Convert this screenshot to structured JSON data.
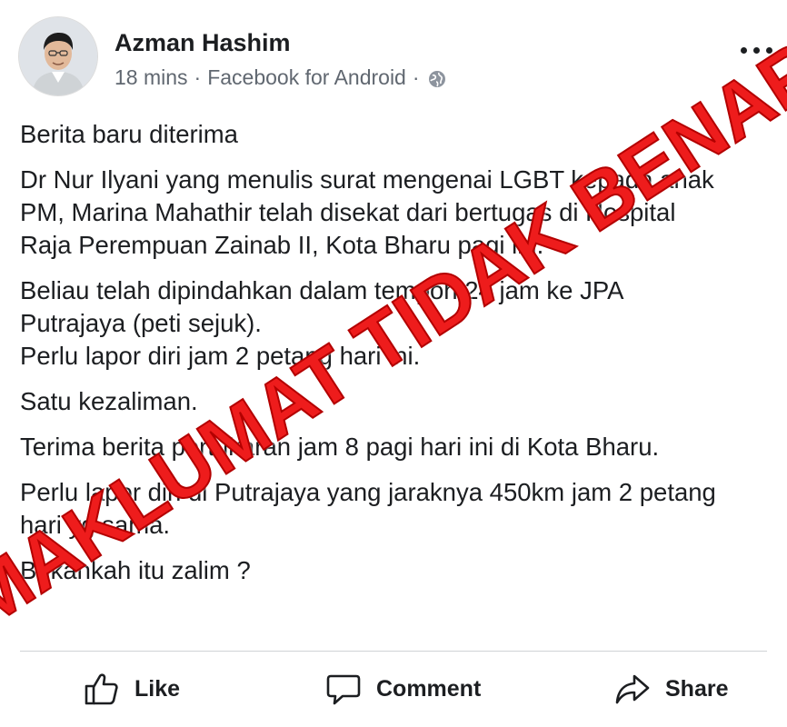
{
  "post": {
    "author": "Azman Hashim",
    "time": "18 mins",
    "source": "Facebook for Android",
    "separator": "·",
    "privacy_icon": "globe-icon",
    "paragraphs": [
      "Berita baru diterima",
      "Dr Nur Ilyani yang menulis surat mengenai LGBT kepada anak\nPM, Marina Mahathir telah disekat dari bertugas di Hospital\nRaja Perempuan Zainab II, Kota Bharu pagi ini.",
      "Beliau telah dipindahkan dalam tempoh 24 jam ke JPA\nPutrajaya (peti sejuk).\nPerlu lapor diri jam 2 petang hari ini.",
      "Satu kezaliman.",
      "Terima berita pertukaran jam 8 pagi hari ini di Kota Bharu.",
      "Perlu lapor diri di Putrajaya yang jaraknya 450km jam 2 petang\nhari yg sama.",
      "Bukankah itu zalim ?"
    ]
  },
  "stamp": {
    "text": "MAKLUMAT TIDAK BENAR",
    "color": "#ee1c1c"
  },
  "actions": {
    "like": "Like",
    "comment": "Comment",
    "share": "Share"
  }
}
